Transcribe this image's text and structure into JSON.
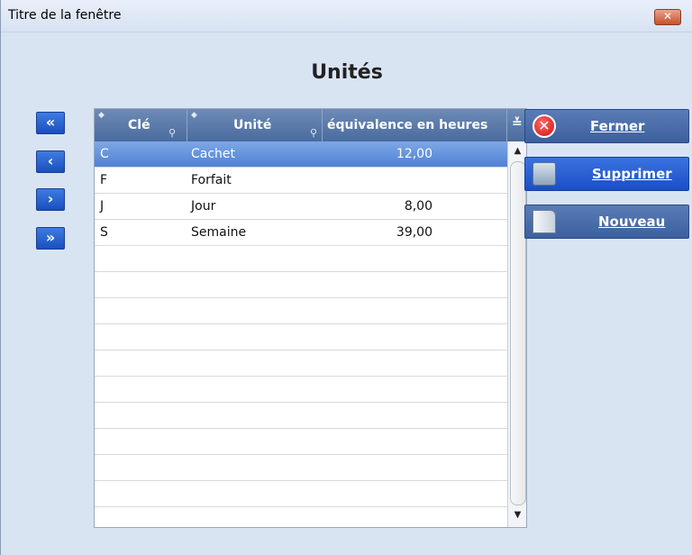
{
  "window": {
    "title": "Titre de la fenêtre",
    "close_glyph": "✕"
  },
  "page": {
    "title": "Unités"
  },
  "nav": {
    "first": "«",
    "prev": "‹",
    "next": "›",
    "last": "»"
  },
  "table": {
    "columns": [
      "Clé",
      "Unité",
      "équivalence en heures"
    ],
    "rows": [
      {
        "cle": "C",
        "unite": "Cachet",
        "equivalence": "12,00",
        "selected": true
      },
      {
        "cle": "F",
        "unite": "Forfait",
        "equivalence": ""
      },
      {
        "cle": "J",
        "unite": "Jour",
        "equivalence": "8,00"
      },
      {
        "cle": "S",
        "unite": "Semaine",
        "equivalence": "39,00"
      }
    ],
    "header_menu_glyph": "≚",
    "scroll_up": "▲",
    "scroll_down": "▼"
  },
  "actions": {
    "fermer": "Fermer",
    "supprimer": "Supprimer",
    "nouveau": "Nouveau"
  },
  "icons": {
    "close": "close-icon",
    "fermer": "error-x-icon",
    "supprimer": "recycle-bin-icon",
    "nouveau": "new-document-icon"
  },
  "colors": {
    "window_bg": "#d9e4f3",
    "header_bg": "#4a6b9f",
    "selected_row": "#4f82d4",
    "nav_button": "#1b4fbf"
  }
}
